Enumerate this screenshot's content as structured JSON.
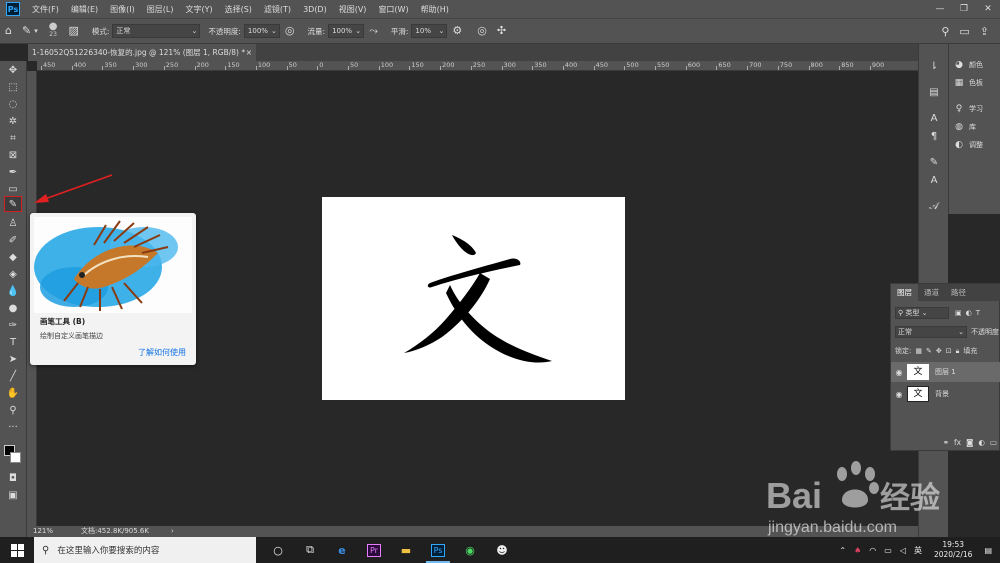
{
  "menubar": {
    "logo": "Ps",
    "items": [
      "文件(F)",
      "编辑(E)",
      "图像(I)",
      "图层(L)",
      "文字(Y)",
      "选择(S)",
      "滤镜(T)",
      "3D(D)",
      "视图(V)",
      "窗口(W)",
      "帮助(H)"
    ]
  },
  "options": {
    "brush_size": "23",
    "mode_label": "模式:",
    "mode_value": "正常",
    "opacity_label": "不透明度:",
    "opacity_value": "100%",
    "flow_label": "流量:",
    "flow_value": "100%",
    "smooth_label": "平滑:",
    "smooth_value": "10%"
  },
  "document": {
    "tab_title": "1-16052Q51226340-恢复的.jpg @ 121% (图层 1, RGB/8) *",
    "glyph": "文",
    "zoom": "121%",
    "doc_size": "文档:452.8K/905.6K"
  },
  "ruler": {
    "ticks": [
      "450",
      "400",
      "350",
      "300",
      "250",
      "200",
      "150",
      "100",
      "50",
      "0",
      "50",
      "100",
      "150",
      "200",
      "250",
      "300",
      "350",
      "400",
      "450",
      "500",
      "550",
      "600",
      "650",
      "700",
      "750",
      "800",
      "850",
      "900"
    ]
  },
  "tooltip": {
    "title": "画笔工具 (B)",
    "description": "绘制自定义画笔描边",
    "link": "了解如何使用"
  },
  "dock": {
    "color": "颜色",
    "swatches": "色板",
    "learn": "学习",
    "libraries": "库",
    "adjustments": "调整"
  },
  "layers": {
    "tabs": [
      "图层",
      "通道",
      "路径"
    ],
    "filter_label": "类型",
    "blend_mode": "正常",
    "opacity_label": "不透明度",
    "lock_label": "锁定:",
    "fill_label": "填充",
    "items": [
      {
        "name": "图层 1",
        "thumb": "文"
      },
      {
        "name": "背景",
        "thumb": "文"
      }
    ]
  },
  "taskbar": {
    "search_placeholder": "在这里输入你要搜索的内容",
    "ime": "英",
    "time": "19:53",
    "date": "2020/2/16"
  },
  "watermark": {
    "brand": "Bai",
    "brand_cn": "经验",
    "url": "jingyan.baidu.com"
  }
}
